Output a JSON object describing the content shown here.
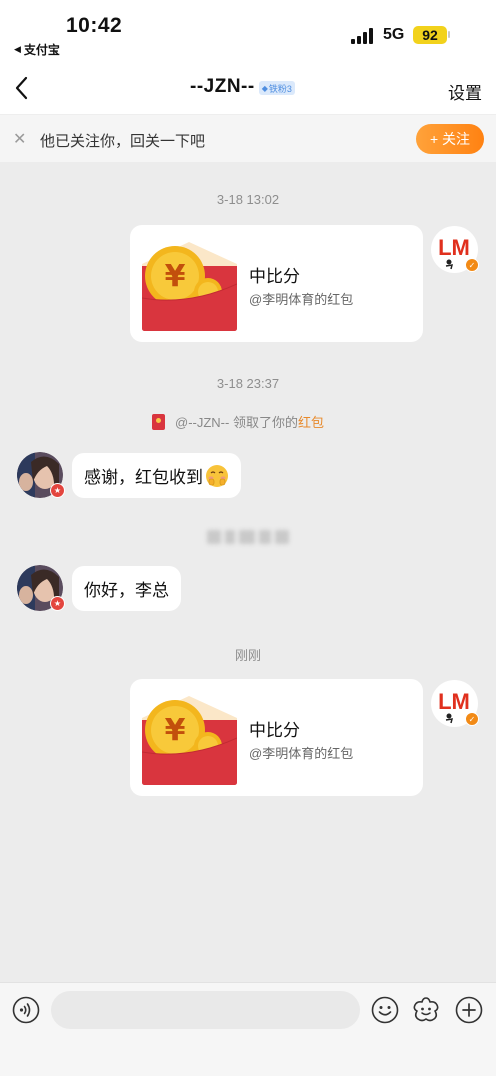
{
  "status_bar": {
    "time": "10:42",
    "back_app": "支付宝",
    "network": "5G",
    "battery": "92"
  },
  "nav": {
    "title": "--JZN--",
    "fan_badge": "铁粉3",
    "settings_label": "设置"
  },
  "follow_banner": {
    "text": "他已关注你，回关一下吧",
    "button_label": "+ 关注"
  },
  "messages": {
    "time1": "3-18 13:02",
    "packet1": {
      "title": "中比分",
      "subtitle": "@李明体育的红包"
    },
    "time2": "3-18 23:37",
    "system_note": {
      "prefix": "@--JZN-- 领取了你的",
      "highlight": "红包"
    },
    "reply1": "感谢，红包收到",
    "reply2": "你好，李总",
    "time3": "刚刚",
    "packet2": {
      "title": "中比分",
      "subtitle": "@李明体育的红包"
    }
  },
  "avatar": {
    "brand_text": "LM"
  },
  "input": {
    "placeholder": ""
  },
  "colors": {
    "accent_orange": "#ff8c1a",
    "packet_red": "#d9353e",
    "coin_gold": "#f6c22a",
    "highlight_text": "#e8892a"
  }
}
